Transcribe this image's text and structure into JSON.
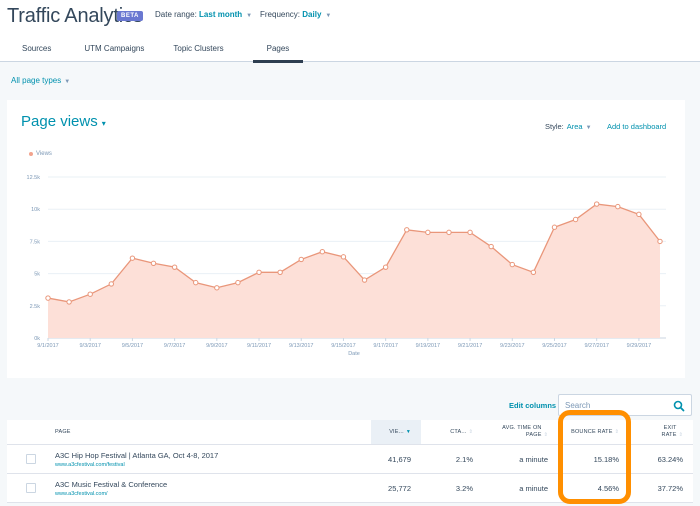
{
  "header": {
    "title": "Traffic Analytics",
    "badge": "BETA",
    "date_range_label": "Date range:",
    "date_range_value": "Last month",
    "frequency_label": "Frequency:",
    "frequency_value": "Daily"
  },
  "tabs": [
    {
      "label": "Sources",
      "active": false
    },
    {
      "label": "UTM Campaigns",
      "active": false
    },
    {
      "label": "Topic Clusters",
      "active": false
    },
    {
      "label": "Pages",
      "active": true
    }
  ],
  "page_type_filter": "All page types",
  "card": {
    "title": "Page views",
    "style_label": "Style:",
    "style_value": "Area",
    "add_to_dashboard": "Add to dashboard"
  },
  "colors": {
    "accent": "#0091ae",
    "series_line": "#e9967a",
    "series_fill": "#fde0d8",
    "highlight": "#ff8f00"
  },
  "chart_data": {
    "type": "area",
    "title": "Page views",
    "xlabel": "Date",
    "ylabel": "",
    "ylim": [
      0,
      12500
    ],
    "yticks": [
      "0k",
      "2.5k",
      "5k",
      "7.5k",
      "10k",
      "12.5k"
    ],
    "ytick_values": [
      0,
      2500,
      5000,
      7500,
      10000,
      12500
    ],
    "xtick_labels": [
      "9/1/2017",
      "9/3/2017",
      "9/5/2017",
      "9/7/2017",
      "9/9/2017",
      "9/11/2017",
      "9/13/2017",
      "9/15/2017",
      "9/17/2017",
      "9/19/2017",
      "9/21/2017",
      "9/23/2017",
      "9/25/2017",
      "9/27/2017",
      "9/29/2017"
    ],
    "grid": true,
    "legend": "top-left",
    "series": [
      {
        "name": "Views",
        "x": [
          "9/1/2017",
          "9/2/2017",
          "9/3/2017",
          "9/4/2017",
          "9/5/2017",
          "9/6/2017",
          "9/7/2017",
          "9/8/2017",
          "9/9/2017",
          "9/10/2017",
          "9/11/2017",
          "9/12/2017",
          "9/13/2017",
          "9/14/2017",
          "9/15/2017",
          "9/16/2017",
          "9/17/2017",
          "9/18/2017",
          "9/19/2017",
          "9/20/2017",
          "9/21/2017",
          "9/22/2017",
          "9/23/2017",
          "9/24/2017",
          "9/25/2017",
          "9/26/2017",
          "9/27/2017",
          "9/28/2017",
          "9/29/2017",
          "9/30/2017"
        ],
        "values": [
          3100,
          2800,
          3400,
          4200,
          6200,
          5800,
          5500,
          4300,
          3900,
          4300,
          5100,
          5100,
          6100,
          6700,
          6300,
          4500,
          5500,
          8400,
          8200,
          8200,
          8200,
          7100,
          5700,
          5100,
          8600,
          9200,
          10400,
          10200,
          9600,
          7500
        ]
      }
    ]
  },
  "table": {
    "edit_columns": "Edit columns",
    "search_placeholder": "Search",
    "columns": [
      "PAGE",
      "VIE...",
      "CTA...",
      "AVG. TIME ON PAGE",
      "BOUNCE RATE",
      "EXIT RATE"
    ],
    "rows": [
      {
        "title": "A3C Hip Hop Festival | Atlanta GA, Oct 4-8, 2017",
        "url": "www.a3cfestival.com/festival",
        "views": "41,679",
        "cta": "2.1%",
        "avg_time": "a minute",
        "bounce_rate": "15.18%",
        "exit_rate": "63.24%"
      },
      {
        "title": "A3C Music Festival & Conference",
        "url": "www.a3cfestival.com/",
        "views": "25,772",
        "cta": "3.2%",
        "avg_time": "a minute",
        "bounce_rate": "4.56%",
        "exit_rate": "37.72%"
      }
    ]
  }
}
